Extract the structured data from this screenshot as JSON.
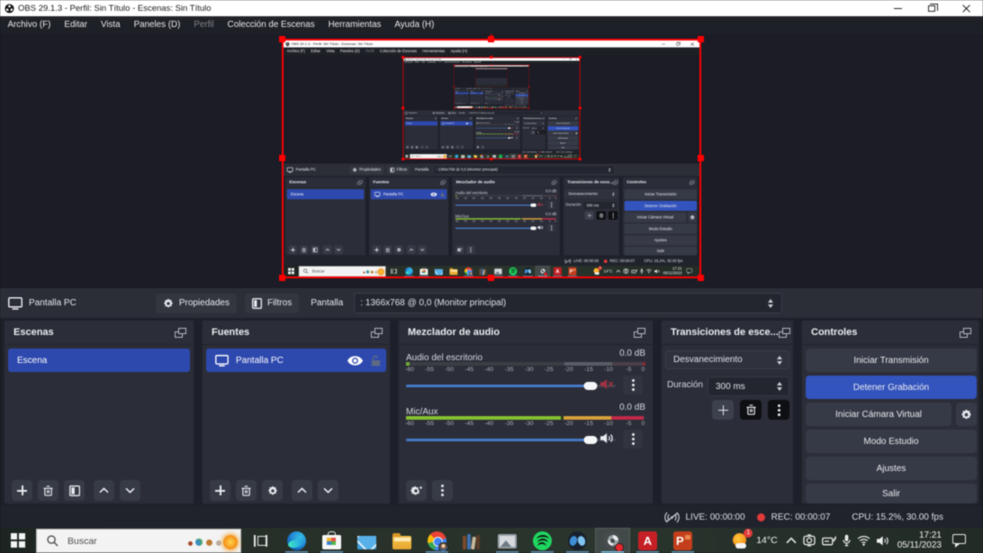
{
  "window": {
    "title": "OBS 29.1.3 - Perfil: Sin Título - Escenas: Sin Título",
    "controls": {
      "minimize": "minimize",
      "restore": "restore",
      "close": "close"
    }
  },
  "menu": {
    "items": [
      {
        "label": "Archivo (F)",
        "enabled": true
      },
      {
        "label": "Editar",
        "enabled": true
      },
      {
        "label": "Vista",
        "enabled": true
      },
      {
        "label": "Paneles (D)",
        "enabled": true
      },
      {
        "label": "Perfil",
        "enabled": false
      },
      {
        "label": "Colección de Escenas",
        "enabled": true
      },
      {
        "label": "Herramientas",
        "enabled": true
      },
      {
        "label": "Ayuda (H)",
        "enabled": true
      }
    ]
  },
  "preview": {
    "selected_source_border_color": "#ff0000",
    "recursion_note": "preview shows the captured screen of this same desktop, recursively"
  },
  "context_bar": {
    "source_name": "Pantalla PC",
    "properties_label": "Propiedades",
    "filters_label": "Filtros",
    "display_label": "Pantalla",
    "display_value": ": 1366x768 @ 0,0 (Monitor principal)"
  },
  "docks": {
    "scenes": {
      "title": "Escenas",
      "items": [
        {
          "name": "Escena",
          "selected": true
        }
      ]
    },
    "sources": {
      "title": "Fuentes",
      "items": [
        {
          "name": "Pantalla PC",
          "selected": true,
          "visible": true,
          "locked": false
        }
      ]
    },
    "mixer": {
      "title": "Mezclador de audio",
      "ticks": [
        "-60",
        "-55",
        "-50",
        "-45",
        "-40",
        "-35",
        "-30",
        "-25",
        "-20",
        "-15",
        "-10",
        "-5",
        "0"
      ],
      "channels": [
        {
          "name": "Audio del escritorio",
          "db": "0.0 dB",
          "muted": true,
          "meter": {
            "green_pct": 1.5,
            "dim1_pct": 66,
            "dim2_pct": 86,
            "dim3_pct": 99
          },
          "volume_pct": 88
        },
        {
          "name": "Mic/Aux",
          "db": "0.0 dB",
          "muted": false,
          "meter": {
            "green_pct": 64.6,
            "orange_pct": 85.8,
            "red_pct": 99.3
          },
          "volume_pct": 88
        }
      ]
    },
    "transitions": {
      "title": "Transiciones de esce...",
      "transition_value": "Desvanecimiento",
      "duration_label": "Duración",
      "duration_value": "300 ms"
    },
    "controls": {
      "title": "Controles",
      "buttons": [
        {
          "label": "Iniciar Transmisión",
          "active": false
        },
        {
          "label": "Detener Grabación",
          "active": true
        },
        {
          "label": "Iniciar Cámara Virtual",
          "active": false,
          "has_gear": true
        },
        {
          "label": "Modo Estudio",
          "active": false
        },
        {
          "label": "Ajustes",
          "active": false
        },
        {
          "label": "Salir",
          "active": false
        }
      ]
    }
  },
  "status_bar": {
    "live": "LIVE: 00:00:00",
    "rec": "REC: 00:00:07",
    "cpu": "CPU: 15.2%, 30.00 fps"
  },
  "taskbar": {
    "search_placeholder": "Buscar",
    "apps": [
      "task-view",
      "edge",
      "store",
      "mail",
      "file-explorer",
      "chrome",
      "books",
      "photos",
      "spotify",
      "blue-app",
      "obs-studio",
      "acrobat",
      "powerpoint"
    ],
    "active_app": "obs-studio",
    "weather_temp": "14°C",
    "weather_badge": "1",
    "clock_time": "17:21",
    "clock_date": "05/11/2023"
  },
  "colors": {
    "accent_blue": "#2e49ae",
    "record_button_blue": "#3353bd",
    "selection_red": "#ff0000",
    "dock_bg": "#2b2d38",
    "window_bg": "#1e2029",
    "titlebar_bg": "#ffffff",
    "meter_green": "#86c232",
    "meter_orange": "#d9a13a",
    "meter_red": "#c22a4a",
    "taskbar_green": "#273029"
  }
}
